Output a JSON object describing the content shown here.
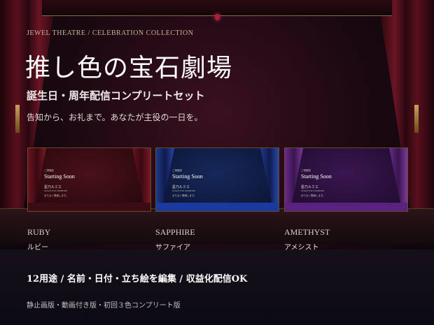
{
  "header": {
    "eyebrow": "JEWEL THEATRE / CELEBRATION COLLECTION",
    "title": "推し色の宝石劇場",
    "subtitle": "誕生日・周年配信コンプリートセット",
    "tagline": "告知から、お礼まで。あなたが主役の一日を。"
  },
  "cards": [
    {
      "label_top": "ご視聴前",
      "screen_title": "Starting Soon",
      "screen_name": "星乃ルミエ",
      "screen_sub": "STAGE FOR SOMEONE",
      "screen_msg": "まもなく開演します。",
      "gem_en": "RUBY",
      "gem_ja": "ルビー"
    },
    {
      "label_top": "ご視聴前",
      "screen_title": "Starting Soon",
      "screen_name": "星乃ルミエ",
      "screen_sub": "STAGE FOR SOMEONE",
      "screen_msg": "まもなく開演します。",
      "gem_en": "SAPPHIRE",
      "gem_ja": "サファイア"
    },
    {
      "label_top": "ご視聴前",
      "screen_title": "Starting Soon",
      "screen_name": "星乃ルミエ",
      "screen_sub": "STAGE FOR SOMEONE",
      "screen_msg": "まもなく開演します。",
      "gem_en": "AMETHYST",
      "gem_ja": "アメシスト"
    }
  ],
  "features": "12用途 / 名前・日付・立ち絵を編集 / 収益化配信OK",
  "editions": "静止画版・動画付き版・初回３色コンプリート版",
  "colors": {
    "ruby": "#6a1420",
    "sapphire": "#1e3a8a",
    "amethyst": "#6a2a8a",
    "gold": "#c9a25a"
  },
  "icons": [
    "curtain-left",
    "curtain-right",
    "chandelier-jewel-icon",
    "tassel-icon"
  ]
}
